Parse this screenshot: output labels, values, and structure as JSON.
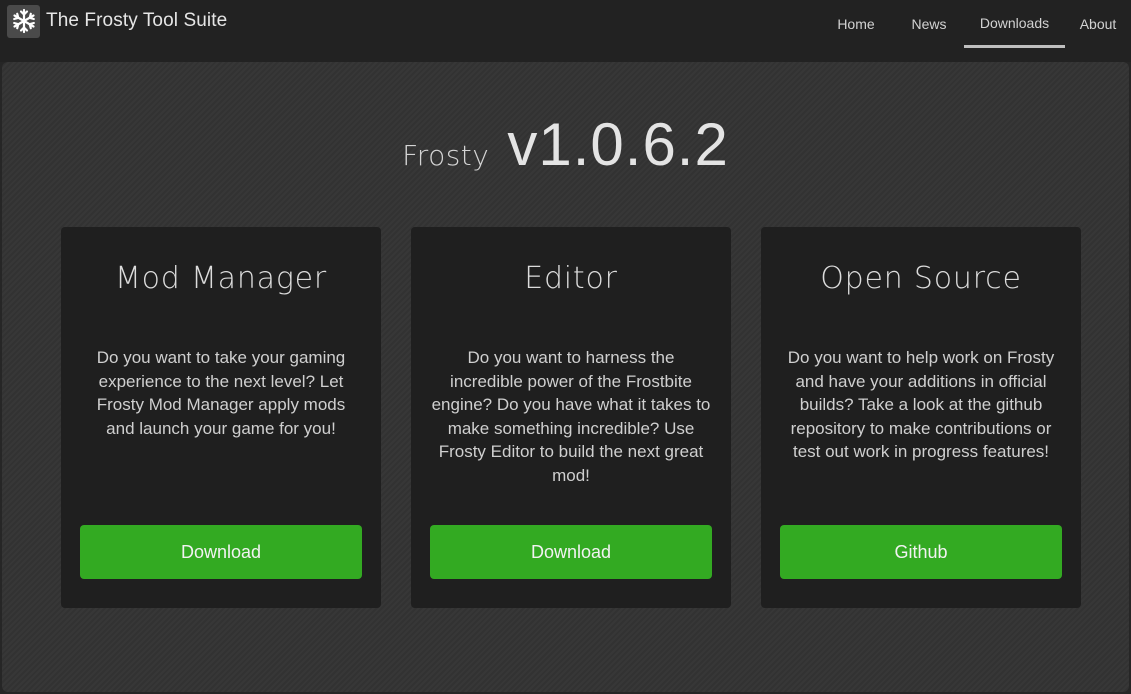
{
  "header": {
    "title": "The Frosty Tool Suite",
    "logo_icon": "snowflake-icon",
    "nav": [
      {
        "label": "Home",
        "active": false
      },
      {
        "label": "News",
        "active": false
      },
      {
        "label": "Downloads",
        "active": true
      },
      {
        "label": "About",
        "active": false
      }
    ]
  },
  "hero": {
    "name": "Frosty",
    "version": "v1.0.6.2"
  },
  "cards": [
    {
      "title": "Mod Manager",
      "description": "Do you want to take your gaming experience to the next level? Let Frosty Mod Manager apply mods and launch your game for you!",
      "button": "Download"
    },
    {
      "title": "Editor",
      "description": "Do you want to harness the incredible power of the Frostbite engine? Do you have what it takes to make something incredible? Use Frosty Editor to build the next great mod!",
      "button": "Download"
    },
    {
      "title": "Open Source",
      "description": "Do you want to help work on Frosty and have your additions in official builds? Take a look at the github repository to make contributions or test out work in progress features!",
      "button": "Github"
    }
  ],
  "colors": {
    "accent_green": "#33aa22",
    "card_bg": "#1f1f1f",
    "page_bg": "#333333",
    "topbar_bg": "#222222"
  }
}
